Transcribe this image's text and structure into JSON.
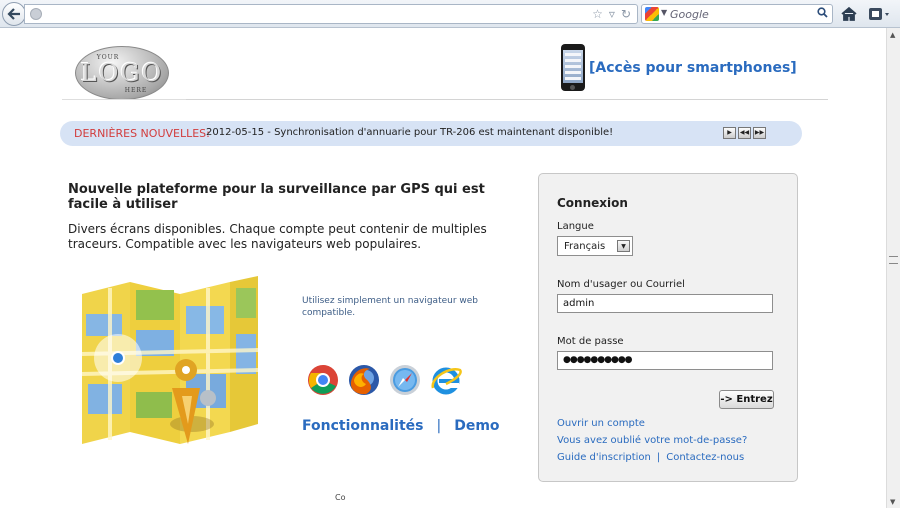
{
  "browser": {
    "search_placeholder": "Google"
  },
  "header": {
    "mobile_link": "[Accès pour smartphones]"
  },
  "logo": {
    "top": "YOUR",
    "word": "LOGO",
    "bottom": "HERE"
  },
  "news": {
    "label": "DERNIÈRES NOUVELLES:",
    "item": "2012-05-15 - Synchronisation d'annuarie pour TR-206 est maintenant disponible!"
  },
  "intro": {
    "headline": "Nouvelle plateforme pour la surveillance par GPS qui est facile à utiliser",
    "description": "Divers écrans disponibles. Chaque compte peut contenir de multiples traceurs. Compatible avec les navigateurs web populaires.",
    "browser_text": "Utilisez simplement un navigateur web compatible."
  },
  "links": {
    "features": "Fonctionnalités",
    "separator": "|",
    "demo": "Demo"
  },
  "login": {
    "title": "Connexion",
    "language_label": "Langue",
    "language_value": "Français",
    "username_label": "Nom d'usager ou Courriel",
    "username_value": "admin",
    "password_label": "Mot de passe",
    "password_value": "●●●●●●●●●●",
    "submit_label": "-> Entrez",
    "open_account": "Ouvrir un compte",
    "forgot_password": "Vous avez oublié votre mot-de-passe?",
    "guide": "Guide d'inscription",
    "link_separator": "|",
    "contact": "Contactez-nous"
  },
  "footer": {
    "copyright_fragment": "Co"
  },
  "colors": {
    "link": "#2a6bbf",
    "news_label": "#d23c3c",
    "news_bar": "#d7e3f5"
  }
}
